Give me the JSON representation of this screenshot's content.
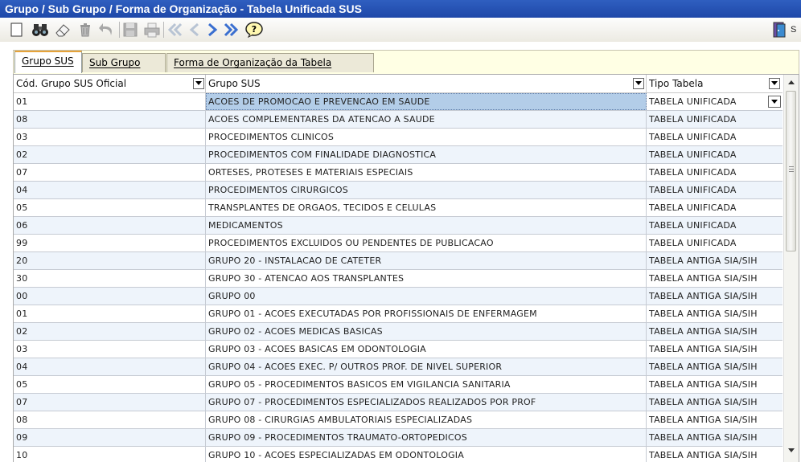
{
  "window": {
    "title": "Grupo / Sub Grupo  / Forma de Organização - Tabela Unificada SUS"
  },
  "toolbar": {
    "icons": [
      "new-document-icon",
      "binoculars-search-icon",
      "eraser-icon",
      "trash-icon",
      "undo-icon",
      "save-icon",
      "print-icon",
      "first-record-icon",
      "previous-record-icon",
      "next-record-icon",
      "last-record-icon",
      "help-icon"
    ],
    "right_label": "S"
  },
  "tabs": [
    {
      "label": "Grupo SUS",
      "active": true
    },
    {
      "label": "Sub Grupo SUS",
      "active": false
    },
    {
      "label": "Forma de Organização da Tabela Unificada",
      "active": false
    }
  ],
  "grid": {
    "columns": [
      "Cód. Grupo SUS Oficial",
      "Grupo SUS",
      "Tipo Tabela"
    ],
    "rows": [
      [
        "01",
        "ACOES DE PROMOCAO E PREVENCAO EM SAUDE",
        "TABELA UNIFICADA"
      ],
      [
        "08",
        "ACOES COMPLEMENTARES DA ATENCAO A SAUDE",
        "TABELA UNIFICADA"
      ],
      [
        "03",
        "PROCEDIMENTOS CLINICOS",
        "TABELA UNIFICADA"
      ],
      [
        "02",
        "PROCEDIMENTOS COM FINALIDADE DIAGNOSTICA",
        "TABELA UNIFICADA"
      ],
      [
        "07",
        "ORTESES, PROTESES E MATERIAIS ESPECIAIS",
        "TABELA UNIFICADA"
      ],
      [
        "04",
        "PROCEDIMENTOS CIRURGICOS",
        "TABELA UNIFICADA"
      ],
      [
        "05",
        "TRANSPLANTES DE ORGAOS, TECIDOS E CELULAS",
        "TABELA UNIFICADA"
      ],
      [
        "06",
        "MEDICAMENTOS",
        "TABELA UNIFICADA"
      ],
      [
        "99",
        "PROCEDIMENTOS EXCLUIDOS OU PENDENTES DE PUBLICACAO",
        "TABELA UNIFICADA"
      ],
      [
        "20",
        "GRUPO 20 - INSTALACAO DE CATETER",
        "TABELA ANTIGA SIA/SIH"
      ],
      [
        "30",
        "GRUPO 30 - ATENCAO AOS TRANSPLANTES",
        "TABELA ANTIGA SIA/SIH"
      ],
      [
        "00",
        "GRUPO 00",
        "TABELA ANTIGA SIA/SIH"
      ],
      [
        "01",
        "GRUPO 01 - ACOES EXECUTADAS POR PROFISSIONAIS DE ENFERMAGEM",
        "TABELA ANTIGA SIA/SIH"
      ],
      [
        "02",
        "GRUPO 02 - ACOES MEDICAS BASICAS",
        "TABELA ANTIGA SIA/SIH"
      ],
      [
        "03",
        "GRUPO 03 - ACOES BASICAS EM ODONTOLOGIA",
        "TABELA ANTIGA SIA/SIH"
      ],
      [
        "04",
        "GRUPO 04 - ACOES EXEC. P/ OUTROS PROF. DE NIVEL SUPERIOR",
        "TABELA ANTIGA SIA/SIH"
      ],
      [
        "05",
        "GRUPO 05 - PROCEDIMENTOS BASICOS EM VIGILANCIA SANITARIA",
        "TABELA ANTIGA SIA/SIH"
      ],
      [
        "07",
        "GRUPO 07 - PROCEDIMENTOS ESPECIALIZADOS REALIZADOS POR PROF",
        "TABELA ANTIGA SIA/SIH"
      ],
      [
        "08",
        "GRUPO 08 - CIRURGIAS AMBULATORIAIS ESPECIALIZADAS",
        "TABELA ANTIGA SIA/SIH"
      ],
      [
        "09",
        "GRUPO 09 - PROCEDIMENTOS TRAUMATO-ORTOPEDICOS",
        "TABELA ANTIGA SIA/SIH"
      ],
      [
        "10",
        "GRUPO 10 - ACOES ESPECIALIZADAS EM ODONTOLOGIA",
        "TABELA ANTIGA SIA/SIH"
      ]
    ]
  }
}
